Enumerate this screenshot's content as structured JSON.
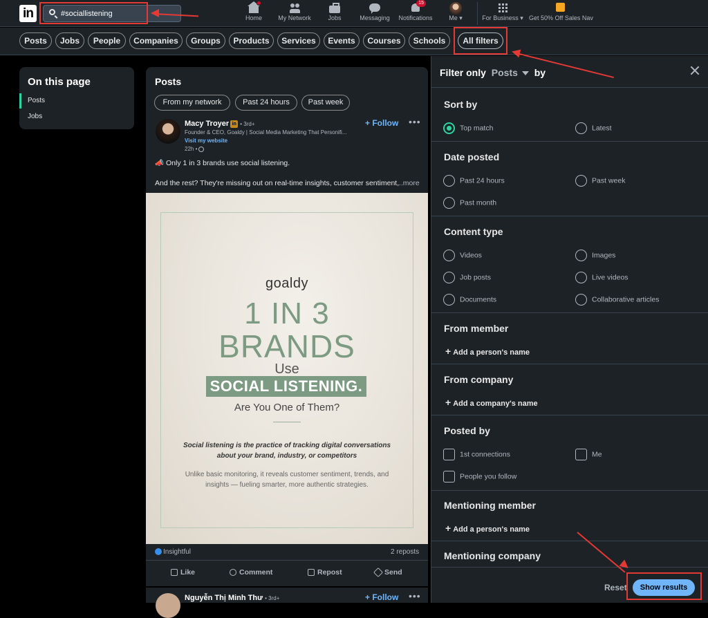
{
  "topnav": {
    "search_value": "#sociallistening",
    "items": [
      {
        "label": "Home"
      },
      {
        "label": "My Network"
      },
      {
        "label": "Jobs"
      },
      {
        "label": "Messaging"
      },
      {
        "label": "Notifications",
        "badge": "15"
      },
      {
        "label": "Me"
      },
      {
        "label": "For Business"
      },
      {
        "label": "Get 50% Off Sales Nav"
      }
    ]
  },
  "filter_pills": [
    "Posts",
    "Jobs",
    "People",
    "Companies",
    "Groups",
    "Products",
    "Services",
    "Events",
    "Courses",
    "Schools",
    "All filters"
  ],
  "on_this_page": {
    "title": "On this page",
    "items": [
      "Posts",
      "Jobs"
    ]
  },
  "posts_section": {
    "title": "Posts",
    "chips": [
      "From my network",
      "Past 24 hours",
      "Past week"
    ]
  },
  "post": {
    "author": "Macy Troyer",
    "degree": "• 3rd+",
    "headline": "Founder & CEO, Goaldy | Social Media Marketing That Personifi...",
    "website": "Visit my website",
    "time": "22h •",
    "follow": "+ Follow",
    "text1": "📣 Only 1 in 3 brands use social listening.",
    "text2": "And the rest? They're missing out on real-time insights, customer sentiment,",
    "see_more": "...more",
    "image": {
      "brand": "goaldy",
      "line1": "1 IN 3",
      "line2": "BRANDS",
      "use": "Use",
      "highlight": "SOCIAL LISTENING.",
      "question": "Are You One of Them?",
      "definition": "Social listening is the practice of tracking digital conversations about your brand, industry, or competitors",
      "description": "Unlike basic monitoring, it reveals customer sentiment, trends, and insights — fueling smarter, more authentic strategies."
    },
    "reactions": "Insightful",
    "reposts": "2 reposts",
    "actions": [
      "Like",
      "Comment",
      "Repost",
      "Send"
    ]
  },
  "post2": {
    "author": "Nguyễn Thị Minh Thư",
    "degree": "• 3rd+",
    "follow": "+ Follow"
  },
  "panel": {
    "filter_only": "Filter only",
    "type": "Posts",
    "by": "by",
    "sort_by": {
      "title": "Sort by",
      "options": [
        "Top match",
        "Latest"
      ],
      "selected": "Top match"
    },
    "date_posted": {
      "title": "Date posted",
      "options": [
        "Past 24 hours",
        "Past week",
        "Past month"
      ]
    },
    "content_type": {
      "title": "Content type",
      "options": [
        "Videos",
        "Images",
        "Job posts",
        "Live videos",
        "Documents",
        "Collaborative articles"
      ]
    },
    "from_member": {
      "title": "From member",
      "add": "Add a person's name"
    },
    "from_company": {
      "title": "From company",
      "add": "Add a company's name"
    },
    "posted_by": {
      "title": "Posted by",
      "options": [
        "1st connections",
        "Me",
        "People you follow"
      ]
    },
    "mentioning_member": {
      "title": "Mentioning member",
      "add": "Add a person's name"
    },
    "mentioning_company": {
      "title": "Mentioning company"
    },
    "reset": "Reset",
    "show_results": "Show results"
  },
  "colors": {
    "accent": "#70b5f9",
    "selected": "#2dd4a0",
    "annotation": "#e53935",
    "brand_green": "#7d9a82"
  }
}
